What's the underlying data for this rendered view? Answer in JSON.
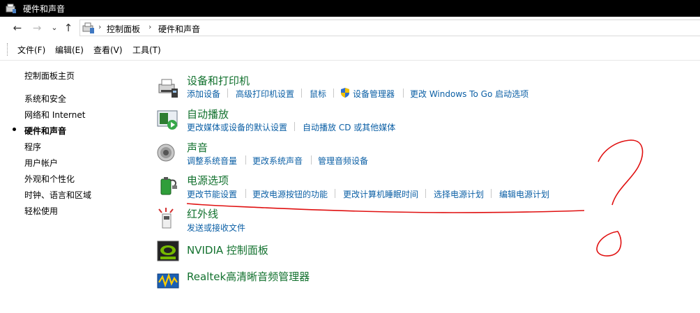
{
  "window": {
    "title": "硬件和声音"
  },
  "address": {
    "crumbs": [
      "控制面板",
      "硬件和声音"
    ],
    "back_glyph": "←",
    "forward_glyph": "→",
    "recent_glyph": "⌄",
    "up_glyph": "↑",
    "sep_glyph": "›"
  },
  "menu": [
    "文件(F)",
    "编辑(E)",
    "查看(V)",
    "工具(T)"
  ],
  "sidebar": {
    "home": "控制面板主页",
    "items": [
      "系统和安全",
      "网络和 Internet",
      "硬件和声音",
      "程序",
      "用户帐户",
      "外观和个性化",
      "时钟、语言和区域",
      "轻松使用"
    ],
    "current_index": 2
  },
  "categories": [
    {
      "title": "设备和打印机",
      "icon": "printer-icon",
      "links": [
        "添加设备",
        "高级打印机设置",
        "鼠标",
        "设备管理器",
        "更改 Windows To Go 启动选项"
      ]
    },
    {
      "title": "自动播放",
      "icon": "autoplay-icon",
      "links": [
        "更改媒体或设备的默认设置",
        "自动播放 CD 或其他媒体"
      ]
    },
    {
      "title": "声音",
      "icon": "speaker-icon",
      "links": [
        "调整系统音量",
        "更改系统声音",
        "管理音频设备"
      ]
    },
    {
      "title": "电源选项",
      "icon": "power-options-icon",
      "links": [
        "更改节能设置",
        "更改电源按钮的功能",
        "更改计算机睡眠时间",
        "选择电源计划",
        "编辑电源计划"
      ]
    },
    {
      "title": "红外线",
      "icon": "infrared-icon",
      "links": [
        "发送或接收文件"
      ]
    },
    {
      "title": "NVIDIA 控制面板",
      "icon": "nvidia-icon",
      "links": []
    },
    {
      "title": "Realtek高清晰音频管理器",
      "icon": "realtek-icon",
      "links": []
    }
  ],
  "colors": {
    "link": "#0b5fa5",
    "category_title": "#12712e",
    "annotation": "#e01010"
  }
}
